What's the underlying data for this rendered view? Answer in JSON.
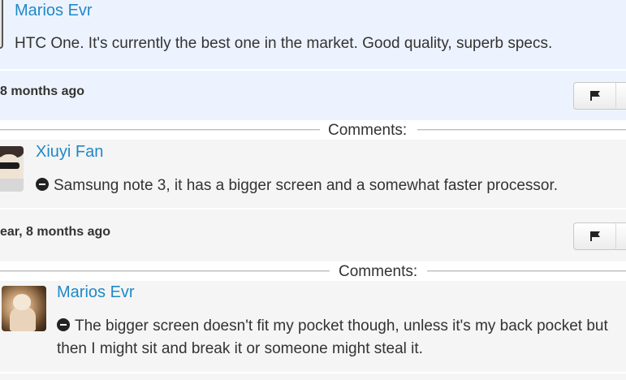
{
  "answer": {
    "author": "Marios Evr",
    "text": "HTC One. It's currently the best one in the market. Good quality, superb specs.",
    "time": "8 months ago"
  },
  "comments_label": "Comments:",
  "comments": [
    {
      "author": "Xiuyi Fan",
      "text": "Samsung note 3, it has a bigger screen and a somewhat faster processor.",
      "time": "ear, 8 months ago"
    },
    {
      "author": "Marios Evr",
      "text_line1": "The bigger screen doesn't fit my pocket though, unless it's my back pocket but",
      "text_line2": "then I might sit and break it or someone might steal it."
    }
  ],
  "icons": {
    "flag": "flag-icon",
    "vote": "minus-circle-icon"
  },
  "colors": {
    "link": "#1f89c8",
    "answer_bg": "#edf3fe",
    "comment_bg": "#f5f5f5"
  }
}
